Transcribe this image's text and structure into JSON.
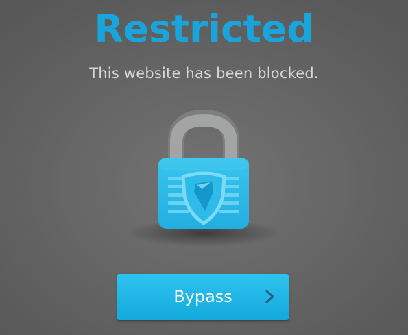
{
  "page": {
    "title": "Restricted",
    "message": "This website has been blocked."
  },
  "lock": {
    "icon": "padlock-icon",
    "emblem": "shield-icon"
  },
  "bypass": {
    "label": "Bypass",
    "icon": "chevron-right-icon"
  },
  "colors": {
    "accent": "#19a5dc",
    "lock_body": "#2fbdea",
    "shackle": "#9a9a9a",
    "message": "#d6d6d6"
  }
}
